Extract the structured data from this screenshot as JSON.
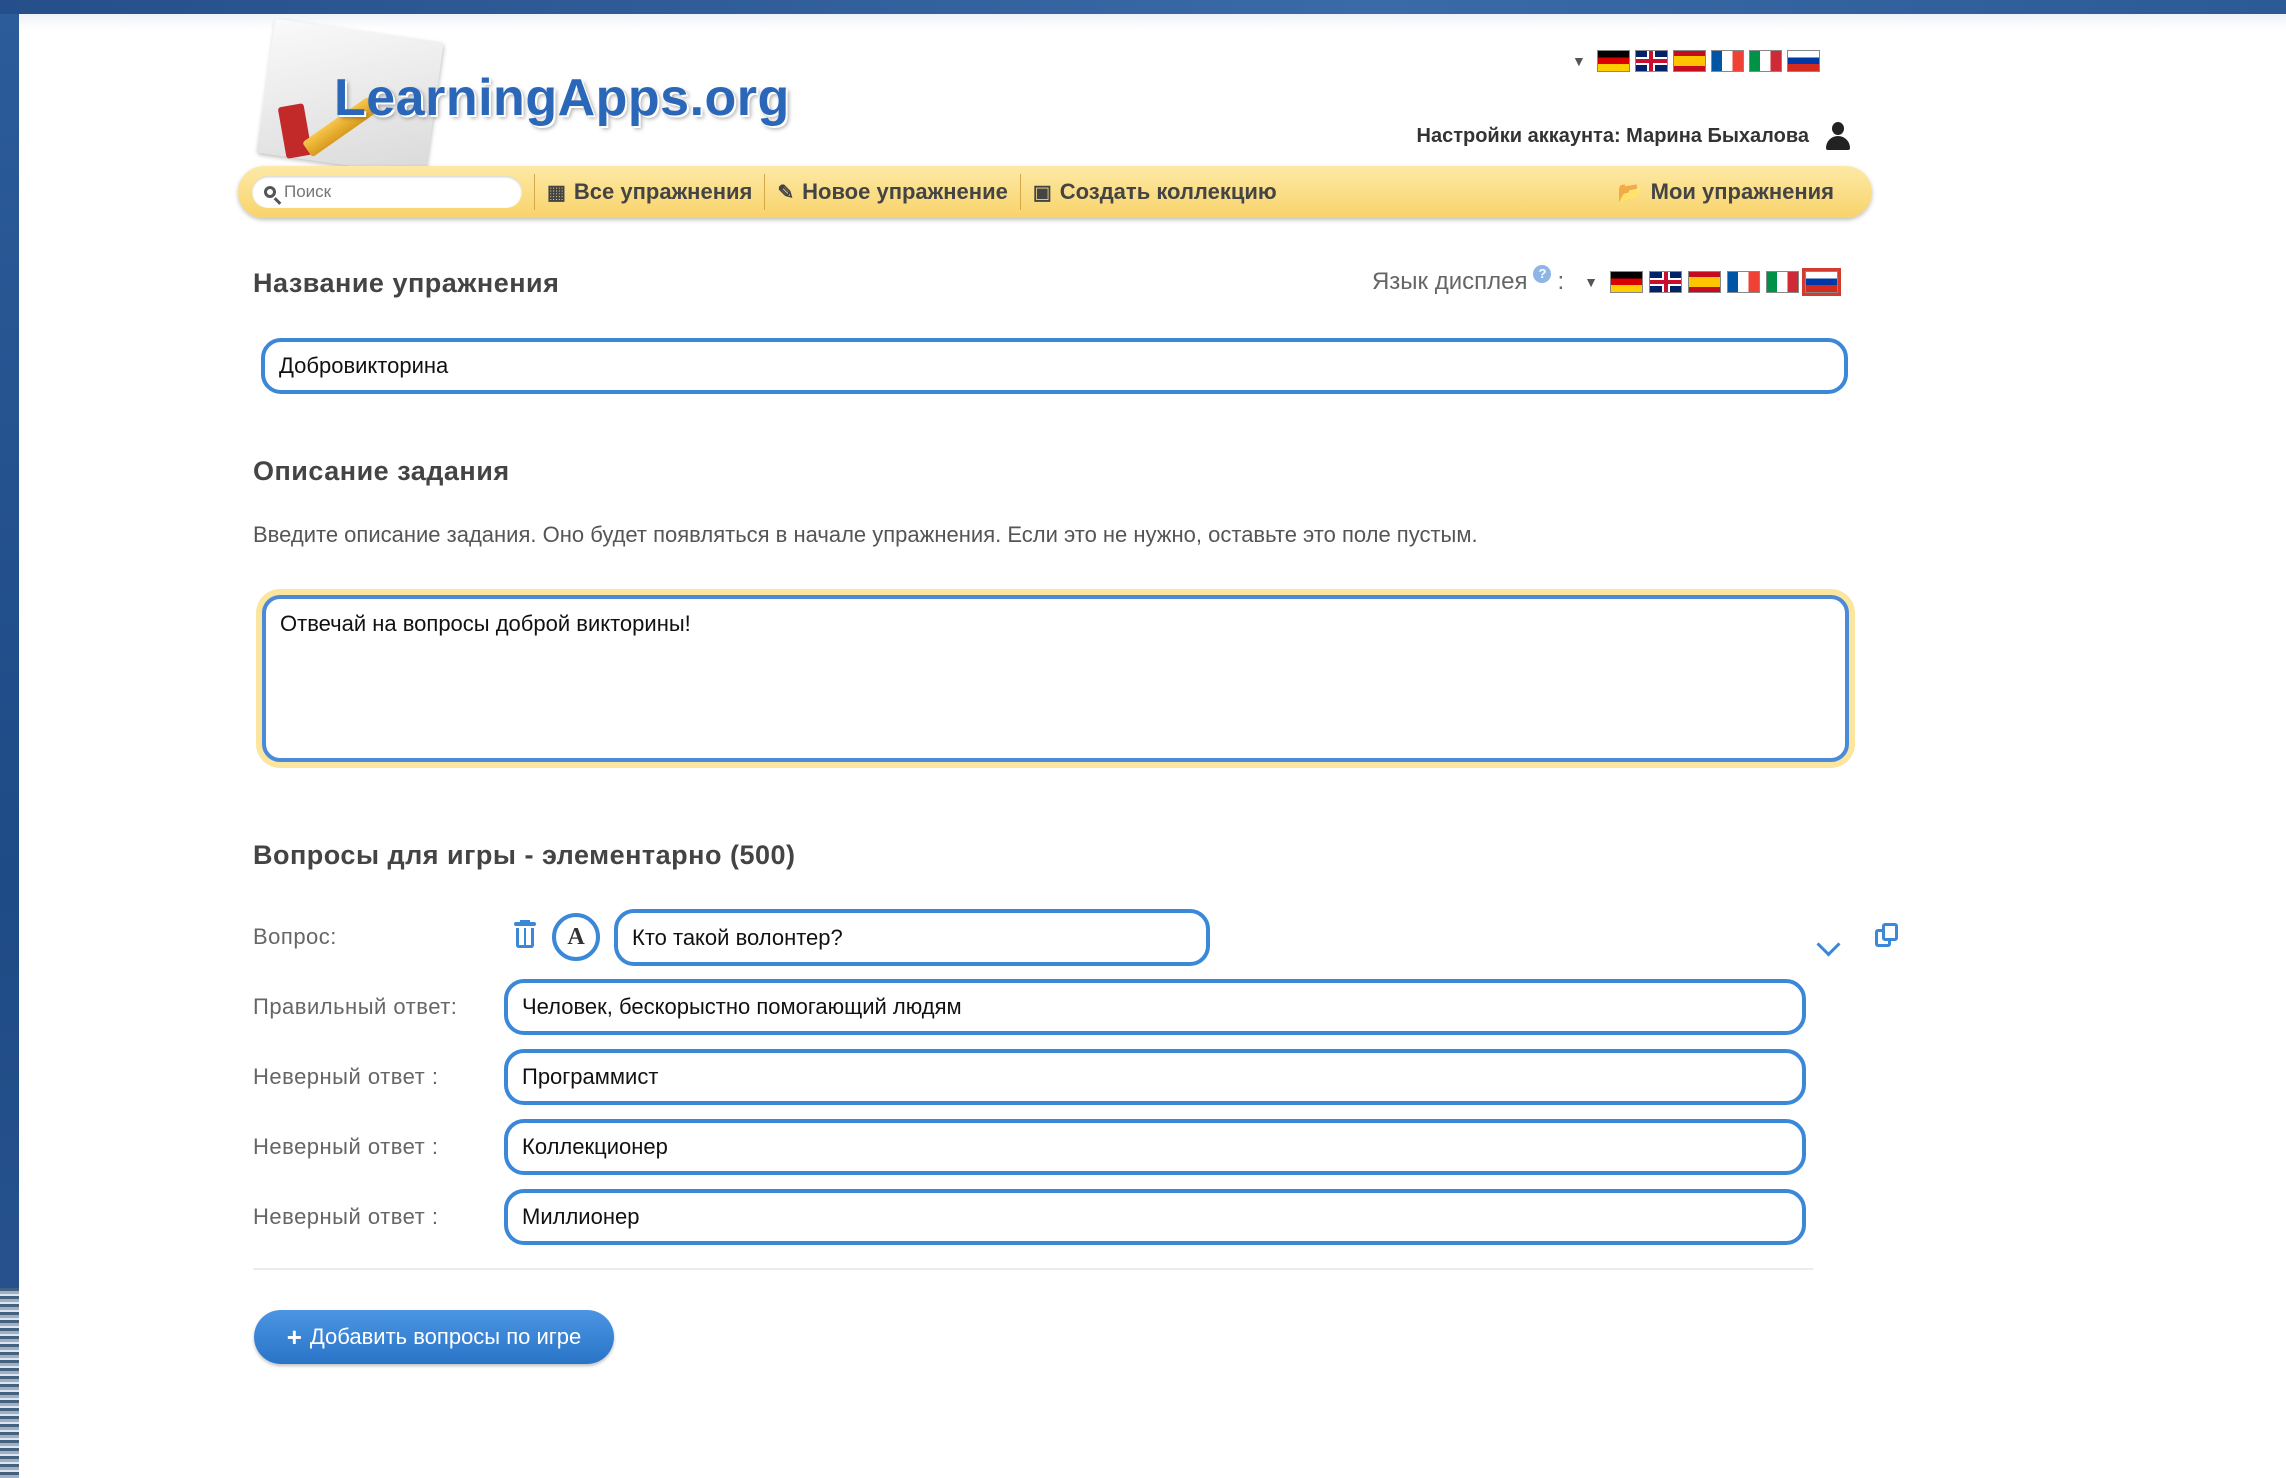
{
  "header": {
    "logo_text": "LearningApps.org",
    "account_text": "Настройки аккаунта: Марина Быхалова"
  },
  "navbar": {
    "search_placeholder": "Поиск",
    "all_exercises": "Все упражнения",
    "new_exercise": "Новое упражнение",
    "create_collection": "Создать коллекцию",
    "my_exercises": "Мои упражнения"
  },
  "languages": [
    "de",
    "en",
    "es",
    "fr",
    "it",
    "ru"
  ],
  "exercise_name": {
    "title": "Название упражнения",
    "display_language_label": "Язык дисплея",
    "help_icon": "?",
    "colon": ":",
    "value": "Добровикторина",
    "selected_language": "ru"
  },
  "task_description": {
    "title": "Описание задания",
    "hint": "Введите описание задания. Оно будет появляться в начале упражнения. Если это не нужно, оставьте это поле пустым.",
    "value": "Отвечай на вопросы доброй викторины!"
  },
  "questions": {
    "title": "Вопросы для игры - элементарно (500)",
    "question_label": "Вопрос:",
    "question_value": "Кто такой волонтер?",
    "text_format_letter": "A",
    "correct_label": "Правильный ответ:",
    "correct_value": "Человек, бескорыстно помогающий людям",
    "wrong_label": "Неверный ответ :",
    "wrong_values": [
      "Программист",
      "Коллекционер",
      "Миллионер"
    ]
  },
  "add_button_label": "Добавить вопросы по игре",
  "colors": {
    "accent_blue": "#3b87d8",
    "navbar_yellow": "#f8d36a",
    "button_blue": "#2a74c8"
  }
}
